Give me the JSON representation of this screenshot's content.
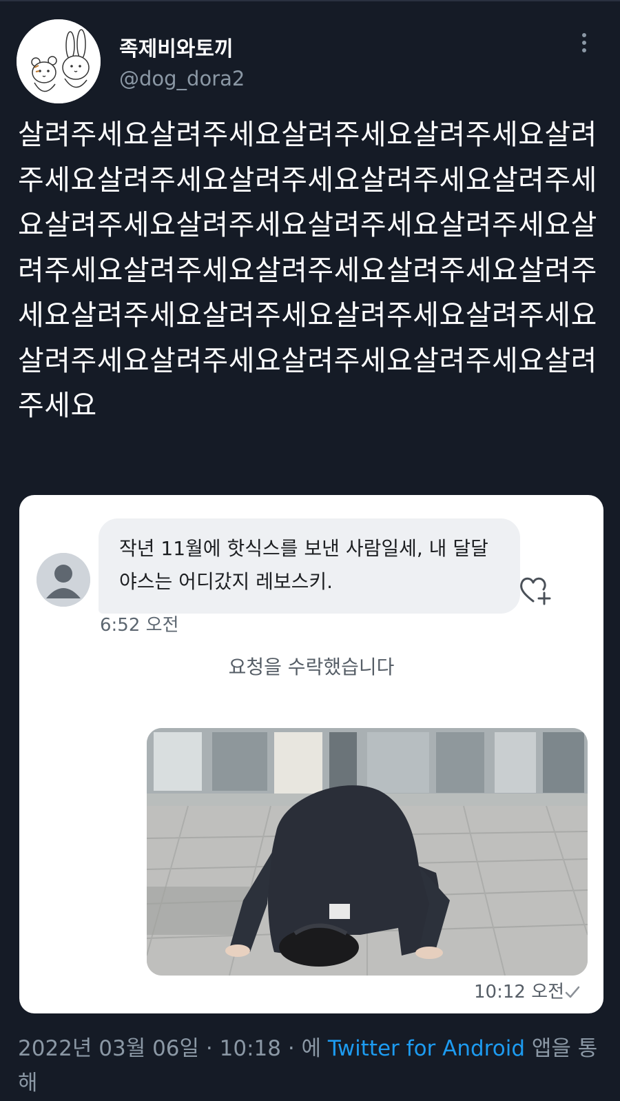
{
  "author": {
    "display_name": "족제비와토끼",
    "handle": "@dog_dora2",
    "avatar_icon": "bear-and-bunny-avatar"
  },
  "more_icon": "more-vertical-icon",
  "tweet": {
    "text": "살려주세요살려주세요살려주세요살려주세요살려주세요살려주세요살려주세요살려주세요살려주세요살려주세요살려주세요살려주세요살려주세요살려주세요살려주세요살려주세요살려주세요살려주세요살려주세요살려주세요살려주세요살려주세요살려주세요살려주세요살려주세요살려주세요살려주세요"
  },
  "screenshot": {
    "received_message": "작년 11월에 핫식스를 보낸 사람일세, 내 달달야스는 어디갔지 레보스키.",
    "received_time": "6:52 오전",
    "system_message": "요청을 수락했습니다",
    "sent_time": "10:12 오전",
    "react_icon": "heart-plus-icon",
    "read_icon": "check-icon"
  },
  "meta": {
    "date": "2022년 03월 06일",
    "separator": " · ",
    "time": "10:18",
    "via_prefix": "에 ",
    "source": "Twitter for Android",
    "via_suffix": " 앱을 통해"
  },
  "colors": {
    "background": "#151b26",
    "link": "#1d9bf0",
    "muted": "#8b98a5"
  }
}
